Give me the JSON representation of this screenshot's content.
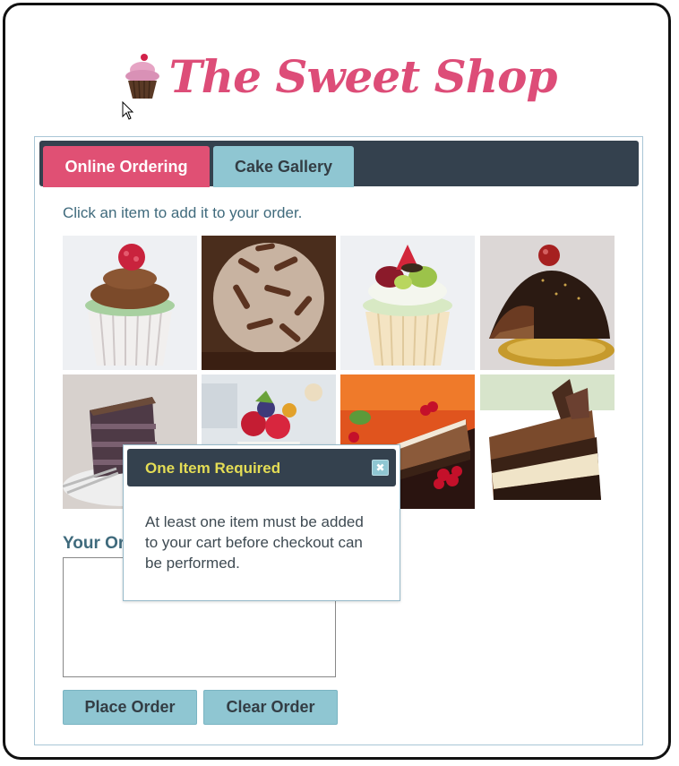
{
  "app": {
    "title": "The Sweet Shop",
    "logo_icon": "cupcake-icon",
    "brand_color": "#dd4d78"
  },
  "tabs": [
    {
      "label": "Online Ordering",
      "active": true
    },
    {
      "label": "Cake Gallery",
      "active": false
    }
  ],
  "hint": "Click an item to add it to your order.",
  "gallery": [
    {
      "icon": "raspberry-cupcake-image"
    },
    {
      "icon": "chocolate-curl-cupcake-image"
    },
    {
      "icon": "fruit-cupcake-image"
    },
    {
      "icon": "chocolate-dome-cake-image"
    },
    {
      "icon": "layer-cake-slice-image"
    },
    {
      "icon": "berry-parfait-image"
    },
    {
      "icon": "chocolate-cheesecake-image"
    },
    {
      "icon": "mousse-cake-slice-image"
    }
  ],
  "order": {
    "label": "Your Order",
    "value": "",
    "place_label": "Place Order",
    "clear_label": "Clear Order"
  },
  "dialog": {
    "title": "One Item Required",
    "message": "At least one item must be added to your cart before checkout can be performed.",
    "close_icon": "close-icon",
    "title_color": "#e4dd55"
  },
  "colors": {
    "tabbar": "#34414e",
    "active_tab": "#e05074",
    "inactive_tab": "#8fc6d2",
    "text": "#3f6a7c"
  }
}
